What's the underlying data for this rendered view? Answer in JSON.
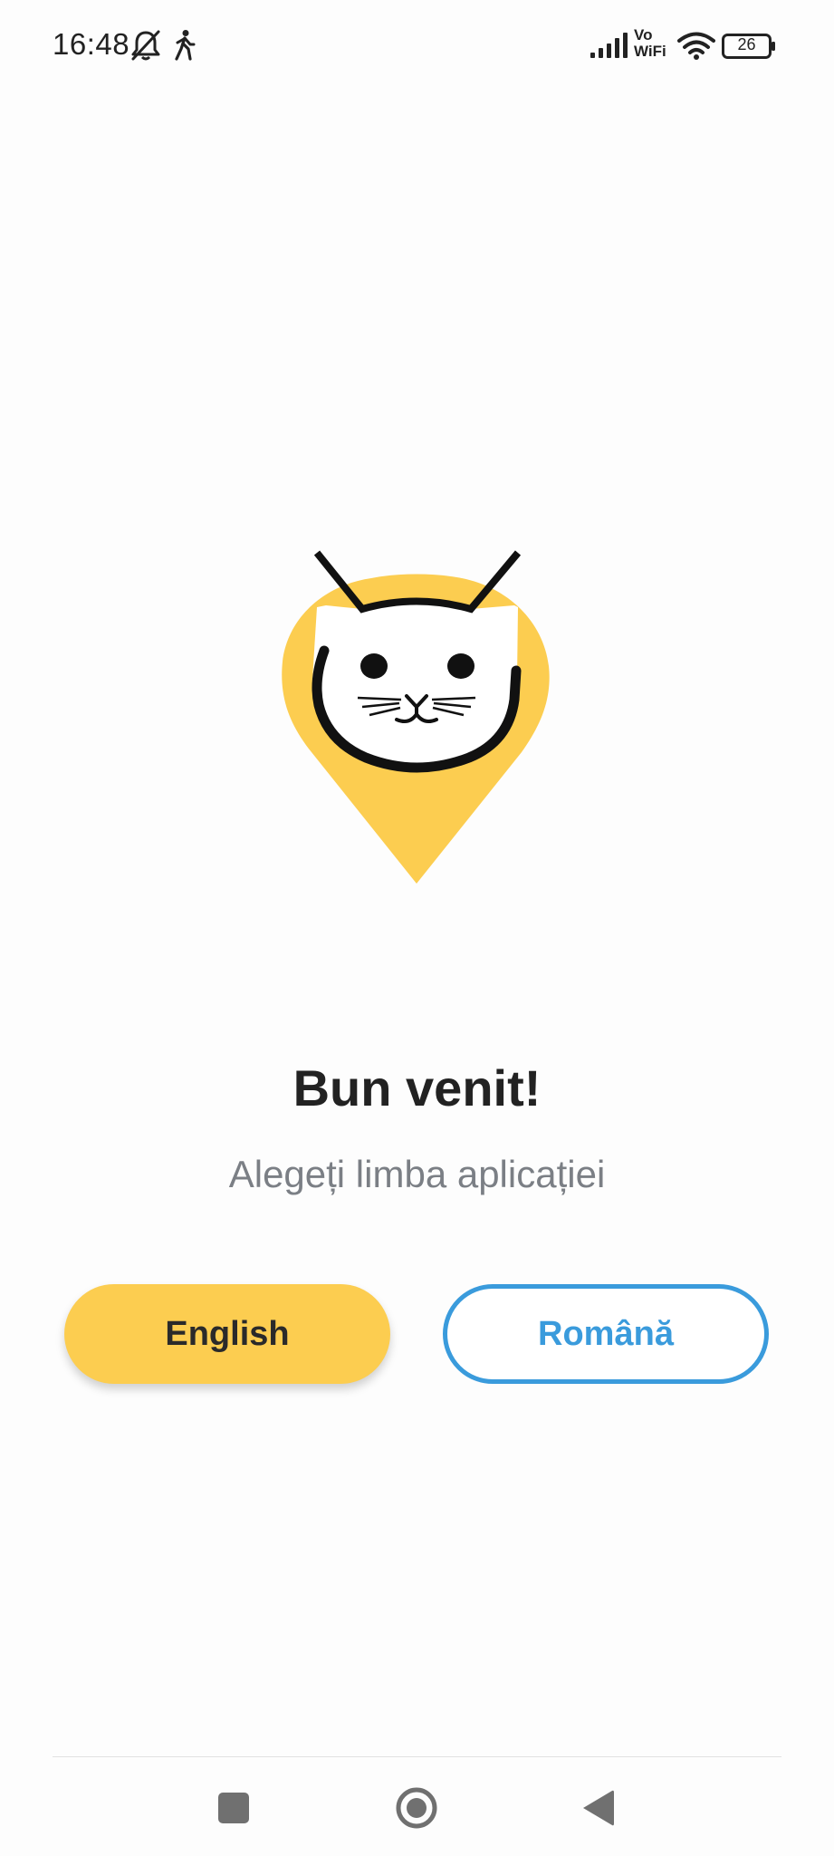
{
  "status_bar": {
    "time": "16:48",
    "icons": [
      "bell-off-icon",
      "walking-icon",
      "signal-icon",
      "vowifi-icon",
      "wifi-icon",
      "battery-icon"
    ],
    "vowifi_top": "Vo",
    "vowifi_bottom": "WiFi",
    "battery_level": "26"
  },
  "logo": {
    "icon": "cat-map-pin-logo",
    "pin_color": "#fccd50"
  },
  "welcome": {
    "title": "Bun venit!",
    "subtitle": "Alegeți limba aplicației"
  },
  "language_buttons": {
    "english_label": "English",
    "romana_label": "Română"
  },
  "colors": {
    "accent_yellow": "#fccd50",
    "accent_blue": "#3a9bdc"
  },
  "nav_bar": {
    "icons": [
      "recents-square-icon",
      "home-circle-icon",
      "back-triangle-icon"
    ]
  }
}
